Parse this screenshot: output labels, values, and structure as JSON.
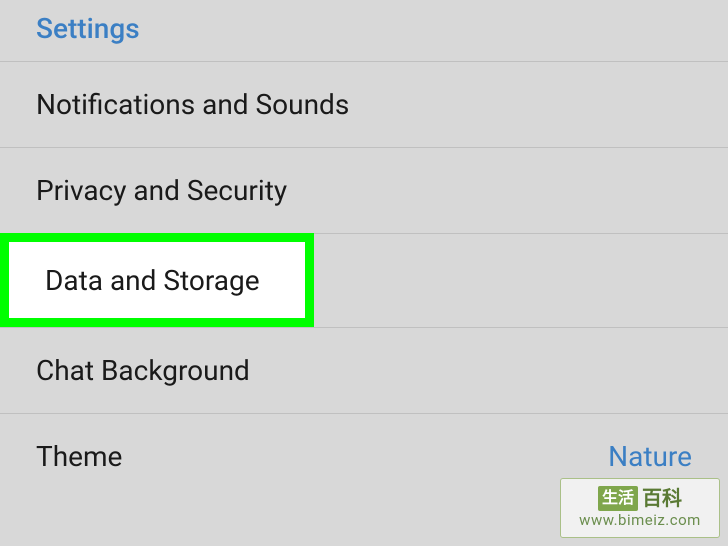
{
  "header": {
    "title": "Settings"
  },
  "menu": {
    "items": [
      {
        "label": "Notifications and Sounds",
        "value": ""
      },
      {
        "label": "Privacy and Security",
        "value": ""
      },
      {
        "label": "Data and Storage",
        "value": "",
        "highlighted": true
      },
      {
        "label": "Chat Background",
        "value": ""
      },
      {
        "label": "Theme",
        "value": "Nature"
      }
    ]
  },
  "watermark": {
    "cn_box": "生活",
    "cn_text": "百科",
    "url": "www.bimeiz.com"
  },
  "highlight": {
    "color": "#00ff00"
  }
}
